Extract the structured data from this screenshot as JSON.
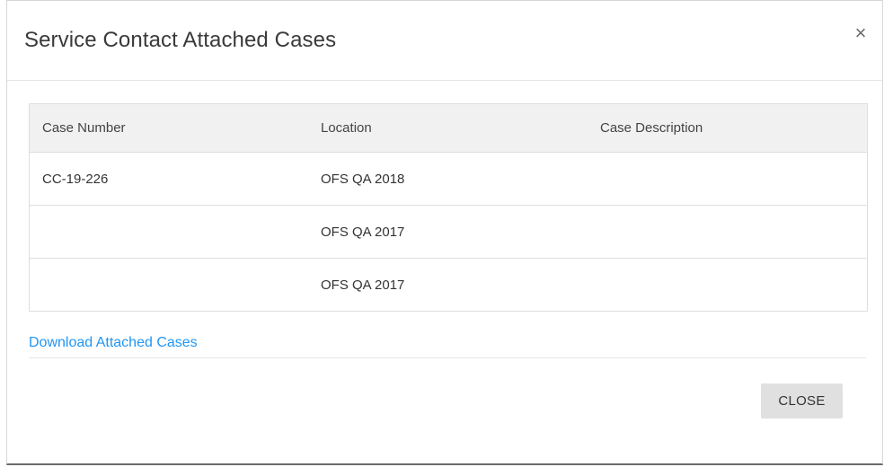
{
  "dialog": {
    "title": "Service Contact Attached Cases",
    "close_icon": "×"
  },
  "table": {
    "headers": [
      "Case Number",
      "Location",
      "Case Description"
    ],
    "rows": [
      {
        "case_number": "CC-19-226",
        "location": "OFS QA 2018",
        "description": ""
      },
      {
        "case_number": "",
        "location": "OFS QA 2017",
        "description": ""
      },
      {
        "case_number": "",
        "location": "OFS QA 2017",
        "description": ""
      }
    ]
  },
  "download_link": "Download Attached Cases",
  "footer": {
    "close_label": "CLOSE"
  }
}
